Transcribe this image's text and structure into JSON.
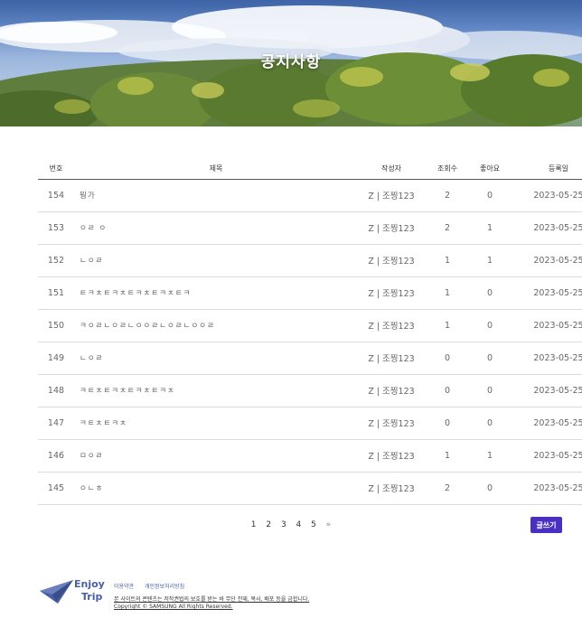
{
  "hero": {
    "title": "공지사항"
  },
  "table": {
    "headers": {
      "no": "번호",
      "title": "제목",
      "writer": "작성자",
      "views": "조회수",
      "likes": "좋아요",
      "date": "등록일"
    },
    "rows": [
      {
        "no": "154",
        "title": "뭥가",
        "writer": "Z | 조찡123",
        "views": "2",
        "likes": "0",
        "date": "2023-05-25"
      },
      {
        "no": "153",
        "title": "ㅇㄹ   ㅇ",
        "writer": "Z | 조찡123",
        "views": "2",
        "likes": "1",
        "date": "2023-05-25"
      },
      {
        "no": "152",
        "title": "ㄴㅇㄹ",
        "writer": "Z | 조찡123",
        "views": "1",
        "likes": "1",
        "date": "2023-05-25"
      },
      {
        "no": "151",
        "title": "ㅌㅋㅊㅌㅋㅊㅌㅋㅊㅌㅋㅊㅌㅋ",
        "writer": "Z | 조찡123",
        "views": "1",
        "likes": "0",
        "date": "2023-05-25"
      },
      {
        "no": "150",
        "title": "ㅋㅇㄹㄴㅇㄹㄴㅇㅇㄹㄴㅇㄹㄴㅇㅇㄹ",
        "writer": "Z | 조찡123",
        "views": "1",
        "likes": "0",
        "date": "2023-05-25"
      },
      {
        "no": "149",
        "title": "ㄴㅇㄹ",
        "writer": "Z | 조찡123",
        "views": "0",
        "likes": "0",
        "date": "2023-05-25"
      },
      {
        "no": "148",
        "title": "ㅋㅌㅊㅌㅋㅊㅌㅋㅊㅌㅋㅊ",
        "writer": "Z | 조찡123",
        "views": "0",
        "likes": "0",
        "date": "2023-05-25"
      },
      {
        "no": "147",
        "title": "ㅋㅌㅊㅌㅋㅊ",
        "writer": "Z | 조찡123",
        "views": "0",
        "likes": "0",
        "date": "2023-05-25"
      },
      {
        "no": "146",
        "title": "ㅁㅇㄹ",
        "writer": "Z | 조찡123",
        "views": "1",
        "likes": "1",
        "date": "2023-05-25"
      },
      {
        "no": "145",
        "title": "ㅇㄴㅎ",
        "writer": "Z | 조찡123",
        "views": "2",
        "likes": "0",
        "date": "2023-05-25"
      }
    ]
  },
  "pagination": {
    "pages": [
      "1",
      "2",
      "3",
      "4",
      "5"
    ],
    "next": "»"
  },
  "write_button": "글쓰기",
  "footer": {
    "logo_line1": "Enjoy",
    "logo_line2": "Trip",
    "links": [
      "이용약관",
      "개인정보처리방침"
    ],
    "notice": "본 사이트의 콘텐츠는 저작권법의 보호를 받는 바 무단 전재, 복사, 배포 등을 금합니다.",
    "copyright": "Copyright © SAMSUNG All Rights Reserved."
  },
  "colors": {
    "accent": "#4a2fc0",
    "logo": "#4a5fa0"
  }
}
